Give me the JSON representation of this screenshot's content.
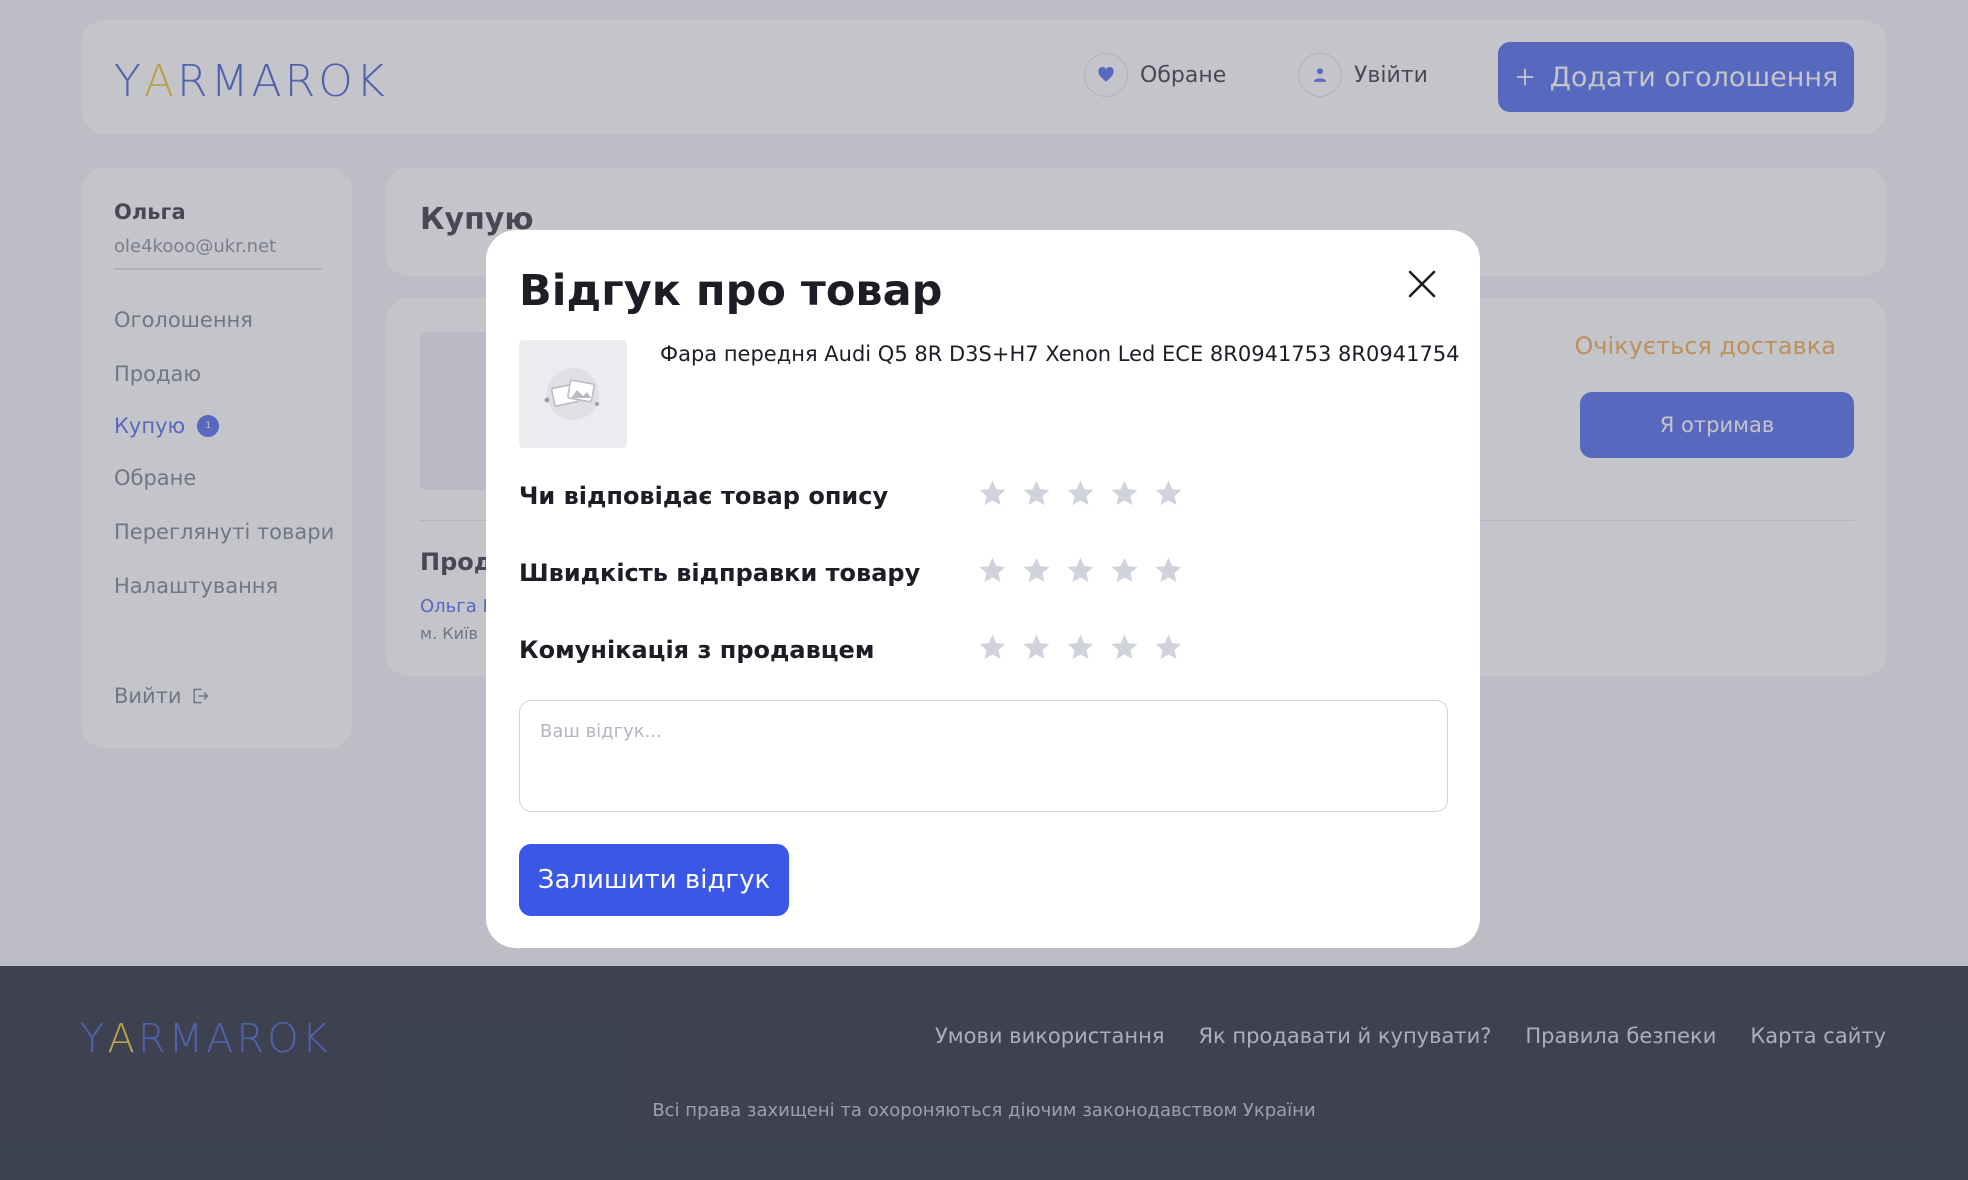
{
  "brand": {
    "logo_a": "Y",
    "logo_b": "A",
    "logo_c": "RMAROK"
  },
  "header": {
    "favorites_label": "Обране",
    "login_label": "Увійти",
    "add_listing_label": "Додати оголошення"
  },
  "sidebar": {
    "user_name": "Ольга",
    "user_email": "ole4kooo@ukr.net",
    "items": [
      {
        "label": "Оголошення"
      },
      {
        "label": "Продаю"
      },
      {
        "label": "Купую",
        "badge": "1"
      },
      {
        "label": "Обране"
      },
      {
        "label": "Переглянуті товари"
      },
      {
        "label": "Налаштування"
      }
    ],
    "logout_label": "Вийти"
  },
  "main": {
    "title": "Купую",
    "order": {
      "status": "Очікується доставка",
      "received_label": "Я отримав",
      "seller_title": "Прод",
      "seller_name": "Ольга М",
      "seller_city": "м. Київ"
    }
  },
  "modal": {
    "title": "Відгук про товар",
    "product_name": "Фара передня Audi Q5 8R D3S+H7 Xenon Led ECE 8R0941753 8R0941754",
    "ratings": [
      {
        "label": "Чи відповідає товар опису",
        "value": 0,
        "max": 5
      },
      {
        "label": "Швидкість відправки товару",
        "value": 0,
        "max": 5
      },
      {
        "label": "Комунікація з продавцем",
        "value": 0,
        "max": 5
      }
    ],
    "review_placeholder": "Ваш відгук...",
    "submit_label": "Залишити відгук"
  },
  "footer": {
    "links": [
      "Умови використання",
      "Як продавати й купувати?",
      "Правила безпеки",
      "Карта сайту"
    ],
    "copyright": "Всі права захищені та охороняються діючим законодавством України"
  },
  "colors": {
    "accent": "#3a57e8",
    "status_pending": "#f0a030",
    "star_empty": "#d0d2dc",
    "footer_bg": "#0b1220",
    "logo_yellow": "#e8c21b"
  },
  "icons": {
    "favorites": "heart-icon",
    "login": "user-icon",
    "add": "plus-icon",
    "logout": "logout-icon",
    "close": "close-icon",
    "rating": "star-icon",
    "thumb": "image-placeholder-icon"
  }
}
